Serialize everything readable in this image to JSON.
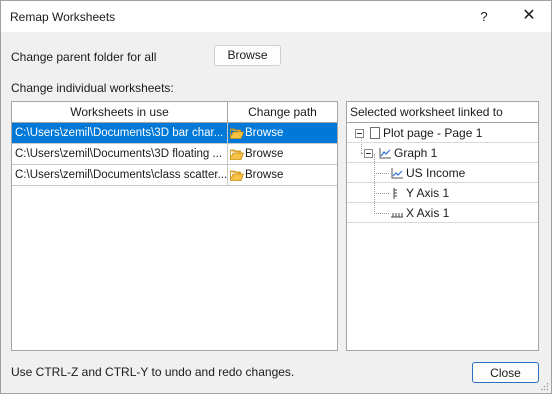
{
  "window": {
    "title": "Remap Worksheets",
    "help_label": "?",
    "close_label": "✕"
  },
  "parent_folder": {
    "label": "Change parent folder for all",
    "browse_label": "Browse"
  },
  "individual": {
    "label": "Change individual worksheets:"
  },
  "grid": {
    "columns": [
      "Worksheets in use",
      "Change path"
    ],
    "rows": [
      {
        "path": "C:\\Users\\zemil\\Documents\\3D bar char...",
        "action": "Browse",
        "selected": true
      },
      {
        "path": "C:\\Users\\zemil\\Documents\\3D floating ...",
        "action": "Browse",
        "selected": false
      },
      {
        "path": "C:\\Users\\zemil\\Documents\\class scatter...",
        "action": "Browse",
        "selected": false
      }
    ]
  },
  "tree": {
    "header": "Selected worksheet linked to",
    "nodes": [
      {
        "label": "Plot page - Page 1",
        "level": 0,
        "icon": "page-icon",
        "expandable": true
      },
      {
        "label": "Graph 1",
        "level": 1,
        "icon": "graph-icon",
        "expandable": true
      },
      {
        "label": "US Income",
        "level": 2,
        "icon": "line-plot-icon",
        "expandable": false
      },
      {
        "label": "Y Axis 1",
        "level": 2,
        "icon": "y-axis-icon",
        "expandable": false
      },
      {
        "label": "X Axis 1",
        "level": 2,
        "icon": "x-axis-icon",
        "expandable": false
      }
    ]
  },
  "footer": {
    "hint": "Use CTRL-Z and CTRL-Y to undo and redo changes.",
    "close_button": "Close"
  },
  "colors": {
    "selection": "#0078d7",
    "close_button_border": "#2b6fc0",
    "dialog_bg": "#f0f0f0"
  }
}
